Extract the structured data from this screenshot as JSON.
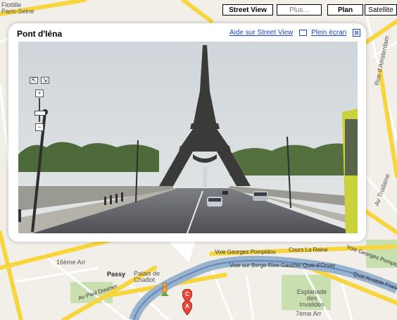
{
  "map_type_buttons": {
    "street_view": "Street View",
    "plus": "Plus...",
    "plan": "Plan",
    "satellite": "Satellite"
  },
  "bubble": {
    "title": "Pont d'Iéna",
    "help_link": "Aide sur Street View",
    "fullscreen_link": "Plein écran",
    "close_symbol": "⊠"
  },
  "streetview_controls": {
    "zoom_in": "+",
    "zoom_out": "−"
  },
  "map_labels": {
    "top_left_1": "Flottille",
    "top_left_2": "Paris-Seine",
    "arr16": "16ème Arr",
    "passy": "Passy",
    "palais_chaillot": "Palais de Chaillot",
    "esplanade": "Esplanade des Invalides",
    "arr7": "7ème Arr",
    "amsterdam": "Rue d'Amsterdam",
    "trudaine": "Av Trudaine"
  },
  "road_labels": {
    "georges_pompidou": "Voie Georges Pompidou",
    "cours_la_reine": "Cours La Reine",
    "berge_rive_gauche": "Voie sur Berge Rive Gauche",
    "quai_orsay": "Quai d'Orsay",
    "paul_doumer": "Av Paul Doumer",
    "quai_anatole": "Quai Anatole France",
    "georges_pompidou_2": "Voie Georges Pompidou"
  },
  "markers": [
    "C",
    "A"
  ],
  "colors": {
    "link": "#1a45c6",
    "road_major": "#f7d53e",
    "road_minor": "#ffffff",
    "water": "#99b3cc",
    "park": "#c9dfaf"
  }
}
